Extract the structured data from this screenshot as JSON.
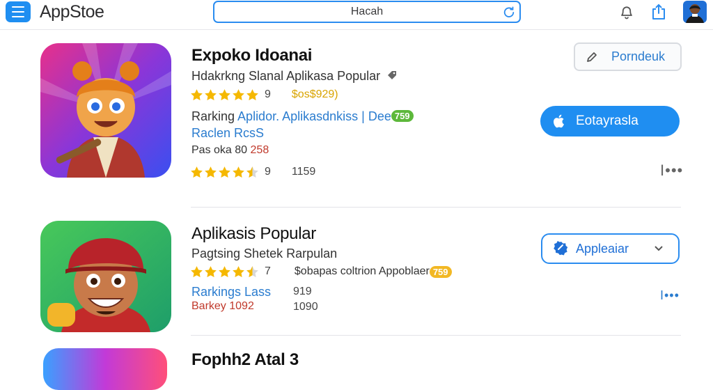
{
  "header": {
    "brand": "AppStoe",
    "search_value": "Hacah",
    "icons": [
      "menu-icon",
      "refresh-icon",
      "bell-icon",
      "share-icon",
      "avatar"
    ]
  },
  "apps": [
    {
      "title": "Expoko Idoanai",
      "subtitle": "Hdakrkng Slanal Aplikasa Popular",
      "rating_count": "9",
      "price": "$os$929)",
      "ranking_label": "Rarking",
      "ranking_link": "Aplidor. Aplikasdnkiss | Dee",
      "ranking_badge": "759",
      "link2": "Raclen RcsS",
      "pas_label": "Pas oka 80",
      "pas_value": "258",
      "rating2_count": "9",
      "rating2_value": "1159",
      "secondary_button": "Porndeuk",
      "primary_button": "Eotayrasla",
      "more": "I•••"
    },
    {
      "title": "Aplikasis Popular",
      "subtitle": "Pagtsing Shetek Rarpulan",
      "rating_count": "7",
      "desc": "$obapas coltrion Appoblaer",
      "badge": "759",
      "link": "Rarkings Lass",
      "link_value": "919",
      "barkey": "Barkey 1092",
      "barkey_value": "1090",
      "button": "Appleaiar",
      "more": "I•••"
    },
    {
      "title": "Fophh2 Atal 3"
    }
  ],
  "colors": {
    "accent": "#1f8ef1",
    "star": "#f5b800",
    "link": "#2a7ccf"
  }
}
